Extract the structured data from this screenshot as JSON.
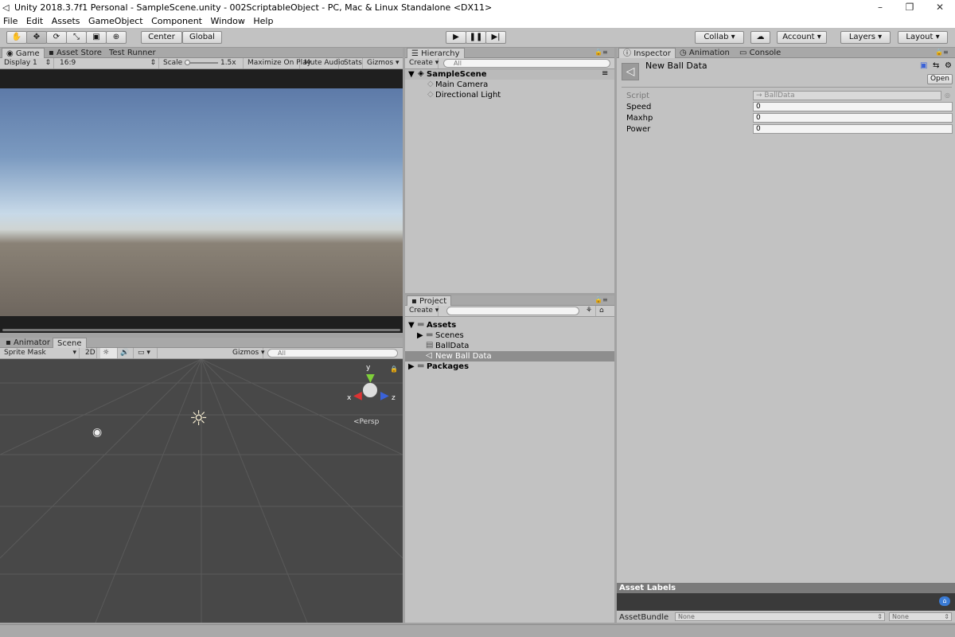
{
  "window": {
    "title": "Unity 2018.3.7f1 Personal - SampleScene.unity - 002ScriptableObject - PC, Mac & Linux Standalone <DX11>"
  },
  "menu": [
    "File",
    "Edit",
    "Assets",
    "GameObject",
    "Component",
    "Window",
    "Help"
  ],
  "toolbar": {
    "pivot": "Center",
    "space": "Global",
    "collab": "Collab ▾",
    "account": "Account",
    "layers": "Layers",
    "layout": "Layout"
  },
  "game_panel": {
    "tabs": [
      "Game",
      "Asset Store",
      "Test Runner"
    ],
    "display": "Display 1",
    "aspect": "16:9",
    "scale_label": "Scale",
    "scale_value": "1.5x",
    "maximize": "Maximize On Play",
    "mute": "Mute Audio",
    "stats": "Stats",
    "gizmos": "Gizmos"
  },
  "scene_panel": {
    "tabs": [
      "Animator",
      "Scene"
    ],
    "sprite_mask": "Sprite Mask",
    "mode_2d": "2D",
    "gizmos": "Gizmos",
    "search_placeholder": "All",
    "gizmo_y": "y",
    "gizmo_x": "x",
    "gizmo_z": "z",
    "persp": "Persp"
  },
  "hierarchy": {
    "tab": "Hierarchy",
    "create": "Create",
    "search_placeholder": "All",
    "scene": "SampleScene",
    "items": [
      "Main Camera",
      "Directional Light"
    ]
  },
  "project": {
    "tab": "Project",
    "create": "Create",
    "root": "Assets",
    "items": [
      "Scenes",
      "BallData",
      "New Ball Data"
    ],
    "packages": "Packages"
  },
  "inspector": {
    "tabs": [
      "Inspector",
      "Animation",
      "Console"
    ],
    "asset_name": "New Ball Data",
    "open": "Open",
    "fields": [
      {
        "label": "Script",
        "value": "BallData"
      },
      {
        "label": "Speed",
        "value": "0"
      },
      {
        "label": "Maxhp",
        "value": "0"
      },
      {
        "label": "Power",
        "value": "0"
      }
    ],
    "asset_labels": "Asset Labels",
    "asset_bundle": "AssetBundle",
    "bundle_value": "None",
    "bundle_variant": "None"
  }
}
